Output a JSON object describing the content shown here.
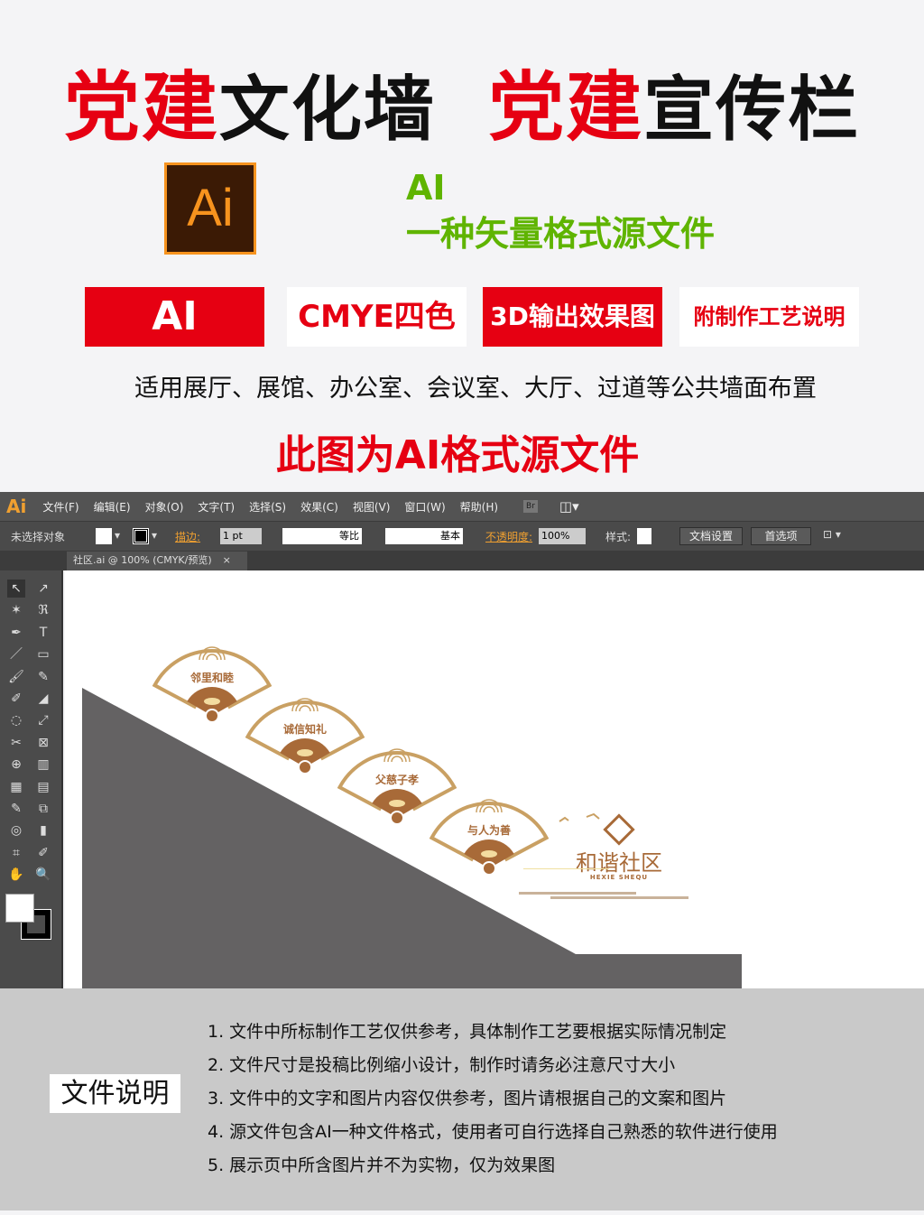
{
  "header": {
    "title_red_1": "党建",
    "title_black_1": "文化墙",
    "title_red_2": "党建",
    "title_black_2": "宣传栏"
  },
  "logo": {
    "text": "Ai"
  },
  "format": {
    "line1": "AI",
    "line2": "一种矢量格式源文件"
  },
  "tags": [
    "AI",
    "CMYE四色",
    "3D输出效果图",
    "附制作工艺说明"
  ],
  "usage": "适用展厅、展馆、办公室、会议室、大厅、过道等公共墙面布置",
  "note": "此图为AI格式源文件",
  "app": {
    "logo": "Ai",
    "menu": [
      "文件(F)",
      "编辑(E)",
      "对象(O)",
      "文字(T)",
      "选择(S)",
      "效果(C)",
      "视图(V)",
      "窗口(W)",
      "帮助(H)"
    ],
    "bridge": "Br",
    "control": {
      "selection": "未选择对象",
      "stroke_label": "描边:",
      "stroke_value": "1 pt",
      "profile": "等比",
      "brush": "基本",
      "opacity_label": "不透明度:",
      "opacity_value": "100%",
      "style_label": "样式:",
      "doc_setup": "文档设置",
      "prefs": "首选项"
    },
    "tab": {
      "title": "社区.ai @ 100% (CMYK/预览)",
      "close": "×"
    }
  },
  "artwork": {
    "fans": [
      "邻里和睦",
      "诚信知礼",
      "父慈子孝",
      "与人为善"
    ],
    "logo_cn": "和谐社区",
    "logo_en": "HEXIE SHEQU",
    "colors": {
      "gold": "#c9a063",
      "brown": "#a86a38",
      "wall": "#646263"
    }
  },
  "doc": {
    "label": "文件说明",
    "items": [
      "1. 文件中所标制作工艺仅供参考，具体制作工艺要根据实际情况制定",
      "2. 文件尺寸是投稿比例缩小设计，制作时请务必注意尺寸大小",
      "3. 文件中的文字和图片内容仅供参考，图片请根据自己的文案和图片",
      "4. 源文件包含AI一种文件格式，使用者可自行选择自己熟悉的软件进行使用",
      "5. 展示页中所含图片并不为实物，仅为效果图"
    ]
  }
}
